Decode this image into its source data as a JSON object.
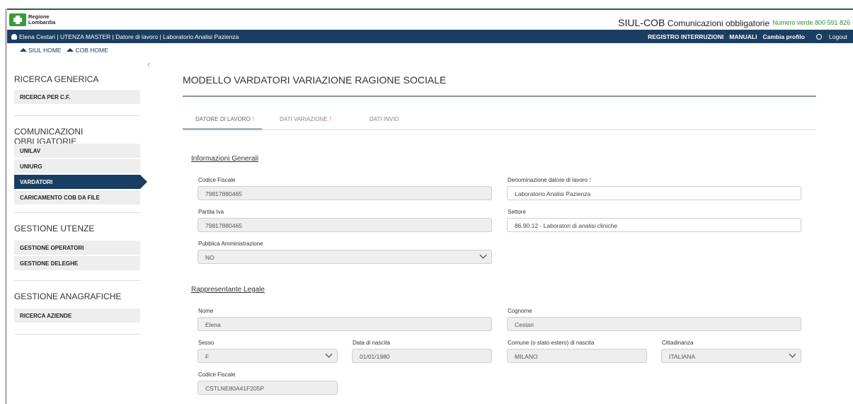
{
  "brand": {
    "logo_line1": "Regione",
    "logo_line2": "Lombardia"
  },
  "header": {
    "app_name": "SIUL-COB",
    "app_subtitle": "Comunicazioni obbligatorie",
    "phone": "Numero verde 800 591 826"
  },
  "userbar": {
    "user_info": "Elena Cestari | UTENZA MASTER | Datore di lavoro | Laboratorio Analisi Pazienza",
    "links": [
      "REGISTRO INTERRUZIONI",
      "MANUALI",
      "Cambia profilo"
    ],
    "logout": "Logout"
  },
  "homelinks": {
    "siul": "SIUL HOME",
    "cob": "COB HOME"
  },
  "sidebar": {
    "sec1": {
      "title": "RICERCA GENERICA",
      "items": [
        "RICERCA PER C.F."
      ]
    },
    "sec2": {
      "title": "COMUNICAZIONI OBBLIGATORIE",
      "items": [
        "UNILAV",
        "UNIURG",
        "VARDATORI",
        "CARICAMENTO COB DA FILE"
      ]
    },
    "sec3": {
      "title": "GESTIONE UTENZE",
      "items": [
        "GESTIONE OPERATORI",
        "GESTIONE DELEGHE"
      ]
    },
    "sec4": {
      "title": "GESTIONE ANAGRAFICHE",
      "items": [
        "RICERCA AZIENDE"
      ]
    }
  },
  "main": {
    "title": "MODELLO VARDATORI VARIAZIONE RAGIONE SOCIALE",
    "tabs": [
      {
        "label": "DATORE DI LAVORO",
        "mark": "!"
      },
      {
        "label": "DATI VARIAZIONE",
        "mark": "!"
      },
      {
        "label": "DATI INVIO",
        "mark": ""
      }
    ],
    "info_title": "Informazioni Generali",
    "cf_label": "Codice Fiscale",
    "cf_value": "79817880465",
    "denominazione_label": "Denominazione datore di lavoro",
    "required_mark": "!",
    "denominazione_value": "Laboratorio Analisi Pazienza",
    "piva_label": "Partita Iva",
    "piva_value": "79817880465",
    "settore_label": "Settore",
    "settore_value": "86.90.12 - Laboratori di analisi cliniche",
    "pa_label": "Pubblica Amministrazione",
    "pa_value": "NO",
    "rep_title": "Rappresentante Legale",
    "nome_label": "Nome",
    "nome_value": "Elena",
    "cognome_label": "Cognome",
    "cognome_value": "Cestari",
    "sesso_label": "Sesso",
    "sesso_value": "F",
    "nascita_label": "Data di nascita",
    "nascita_value": "01/01/1980",
    "comune_label": "Comune (o stato estero) di nascita",
    "comune_value": "MILANO",
    "cittadinanza_label": "Cittadinanza",
    "cittadinanza_value": "ITALIANA",
    "cf2_label": "Codice Fiscale",
    "cf2_value": "CSTLNE80A41F205P"
  }
}
